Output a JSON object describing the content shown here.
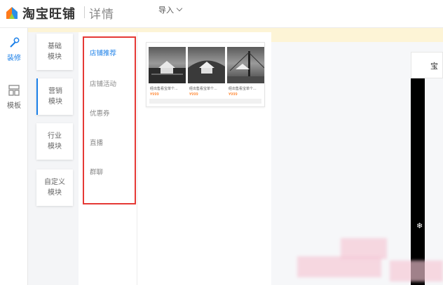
{
  "header": {
    "brand": "淘宝旺铺",
    "subtitle": "详情",
    "import_menu": "导入"
  },
  "rail": {
    "items": [
      {
        "label": "装修",
        "icon": "brush-icon",
        "active": true
      },
      {
        "label": "模板",
        "icon": "template-icon",
        "active": false
      }
    ]
  },
  "categories": {
    "items": [
      {
        "line1": "基础",
        "line2": "模块",
        "active": false
      },
      {
        "line1": "营销",
        "line2": "模块",
        "active": true
      },
      {
        "line1": "行业",
        "line2": "模块",
        "active": false
      },
      {
        "line1": "自定义",
        "line2": "模块",
        "active": false
      }
    ]
  },
  "submenu": {
    "items": [
      {
        "label": "店铺推荐",
        "active": true
      },
      {
        "label": "店铺活动",
        "active": false
      },
      {
        "label": "优惠券",
        "active": false
      },
      {
        "label": "直播",
        "active": false
      },
      {
        "label": "群聊",
        "active": false
      }
    ]
  },
  "component": {
    "products": [
      {
        "title": "经出售看宝单个...",
        "price": "¥999"
      },
      {
        "title": "经出售看宝单个...",
        "price": "¥999"
      },
      {
        "title": "经出售看宝单个...",
        "price": "¥999"
      }
    ]
  },
  "canvas": {
    "phone_title": "宝"
  },
  "colors": {
    "accent": "#1a7fe8",
    "highlight_border": "#e53935",
    "notice_bg": "#fdf4d6",
    "price": "#ff6a00"
  }
}
